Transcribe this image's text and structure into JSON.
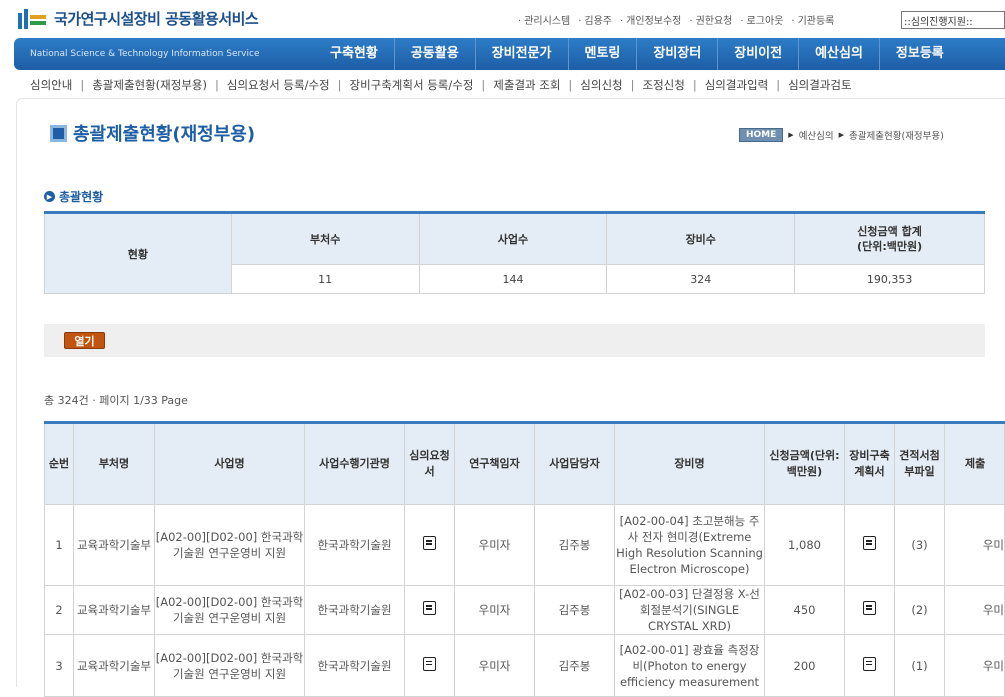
{
  "header": {
    "site_title": "국가연구시설장비 공동활용서비스",
    "util_links": [
      "관리시스템",
      "김용주",
      "개인정보수정",
      "권한요청",
      "로그아웃",
      "기관등록"
    ],
    "select_value": "::심의진행지원::"
  },
  "gnb": {
    "subtitle": "National Science & Technology Information Service",
    "menu": [
      "구축현황",
      "공동활용",
      "장비전문가",
      "멘토링",
      "장비장터",
      "장비이전",
      "예산심의",
      "정보등록"
    ]
  },
  "lnb": [
    "심의안내",
    "총괄제출현황(재정부용)",
    "심의요청서 등록/수정",
    "장비구축계획서 등록/수정",
    "제출결과 조회",
    "심의신청",
    "조정신청",
    "심의결과입력",
    "심의결과검토"
  ],
  "page": {
    "title": "총괄제출현황(재정부용)",
    "breadcrumb": {
      "home": "HOME",
      "path": [
        "예산심의",
        "총괄제출현황(재정부용)"
      ]
    }
  },
  "summary": {
    "section": "총괄현황",
    "row_label": "현황",
    "headers": [
      "부처수",
      "사업수",
      "장비수",
      "신청금액 합계\n(단위:백만원)"
    ],
    "values": [
      "11",
      "144",
      "324",
      "190,353"
    ]
  },
  "toolbar": {
    "open_label": "열기"
  },
  "list": {
    "count_text": "총 324건  ·  페이지 1/33 Page",
    "headers": [
      "순번",
      "부처명",
      "사업명",
      "사업수행기관명",
      "심의요청서",
      "연구책임자",
      "사업담당자",
      "장비명",
      "신청금액(단위:백만원)",
      "장비구축계획서",
      "견적서첨부파일",
      "제출"
    ],
    "rows": [
      {
        "no": "1",
        "ministry": "교육과학기술부",
        "project": "[A02-00][D02-00] 한국과학기술원 연구운영비 지원",
        "org": "한국과학기술원",
        "researcher": "우미자",
        "manager": "김주봉",
        "equipment": "[A02-00-04] 초고분해능 주사 전자 현미경(Extreme High Resolution Scanning Electron Microscope)",
        "amount": "1,080",
        "files": "(3)",
        "submit": "우미"
      },
      {
        "no": "2",
        "ministry": "교육과학기술부",
        "project": "[A02-00][D02-00] 한국과학기술원 연구운영비 지원",
        "org": "한국과학기술원",
        "researcher": "우미자",
        "manager": "김주봉",
        "equipment": "[A02-00-03] 단결정용 X-선 회절분석기(SINGLE CRYSTAL XRD)",
        "amount": "450",
        "files": "(2)",
        "submit": "우미"
      },
      {
        "no": "3",
        "ministry": "교육과학기술부",
        "project": "[A02-00][D02-00] 한국과학기술원 연구운영비 지원",
        "org": "한국과학기술원",
        "researcher": "우미자",
        "manager": "김주봉",
        "equipment": "[A02-00-01] 광효율 측정장비(Photon to energy efficiency measurement",
        "amount": "200",
        "files": "(1)",
        "submit": "우미"
      }
    ]
  }
}
